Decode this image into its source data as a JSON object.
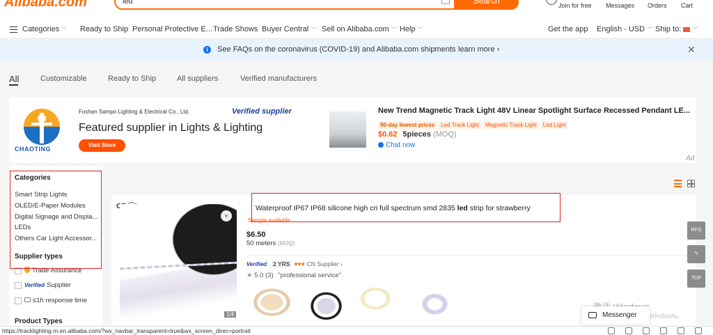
{
  "header": {
    "logo": "Alibaba.com",
    "search_value": "led",
    "search_button": "Search",
    "join_label": "Join for free",
    "messages_label": "Messages",
    "orders_label": "Orders",
    "cart_label": "Cart"
  },
  "nav": {
    "categories": "Categories",
    "items": [
      "Ready to Ship",
      "Personal Protective E...",
      "Trade Shows",
      "Buyer Central",
      "Sell on Alibaba.com",
      "Help"
    ],
    "get_app": "Get the app",
    "language": "English - USD",
    "ship_to": "Ship to:"
  },
  "banner": {
    "text": "See FAQs on the coronavirus (COVID-19) and Alibaba.com shipments",
    "link": "learn more"
  },
  "tabs": [
    "All",
    "Customizable",
    "Ready to Ship",
    "All suppliers",
    "Verified manufacturers"
  ],
  "featured": {
    "logo_text": "CHAOTING",
    "supplier_name": "Foshan Sampo Lighting & Electrical Co., Ltd.",
    "verified_label": "Verified supplier",
    "title": "Featured supplier in Lights & Lighting",
    "visit_button": "Visit Store",
    "product_title": "New Trend Magnetic Track Light 48V Linear Spotlight Surface Recessed Pendant LE...",
    "tags": [
      "90-day lowest prices",
      "Led Track Light",
      "Magnetic Track Light",
      "Led Light"
    ],
    "price": "$0.62",
    "moq_value": "5pieces",
    "moq_tag": "(MOQ)",
    "chat": "Chat now",
    "ad": "Ad"
  },
  "sidebar": {
    "categories_heading": "Categories",
    "categories": [
      "Smart Strip Lights",
      "OLED/E-Paper Modules",
      "Digital Signage and Displa...",
      "LEDs",
      "Others Car Light Accessor..."
    ],
    "supplier_heading": "Supplier types",
    "trade_assurance": "Trade Assurance",
    "verified_prefix": "Verified",
    "verified_supplier": "Supplier",
    "response_time": "≤1h response time",
    "product_types_heading": "Product Types"
  },
  "product": {
    "cert": "CE ⓤL",
    "title_prefix": "Waterproof IP67 IP68 silicone high cri full spectrum smd 2835 ",
    "title_bold": "led",
    "title_suffix": " strip for strawberry",
    "sample": "Sample available",
    "price": "$6.50",
    "moq": "50 meters",
    "moq_tag": "(MOQ)",
    "verified": "Verified",
    "years": "2 YRS",
    "supplier_country": "CN Supplier",
    "rating": "5.0",
    "reviews": "(3)",
    "review_quote": "\"professional service\"",
    "image_count": "1/4"
  },
  "floating": {
    "rfq": "RFQ",
    "top": "TOP"
  },
  "messenger": "Messenger",
  "watermark": {
    "line1": "激活 Windows",
    "line2": "转到\"设置\"以激活 Windows。"
  },
  "status_url": "https://tracklighting.m.en.alibaba.com/?wx_navbar_transparent=true&wx_screen_direc=portrait"
}
